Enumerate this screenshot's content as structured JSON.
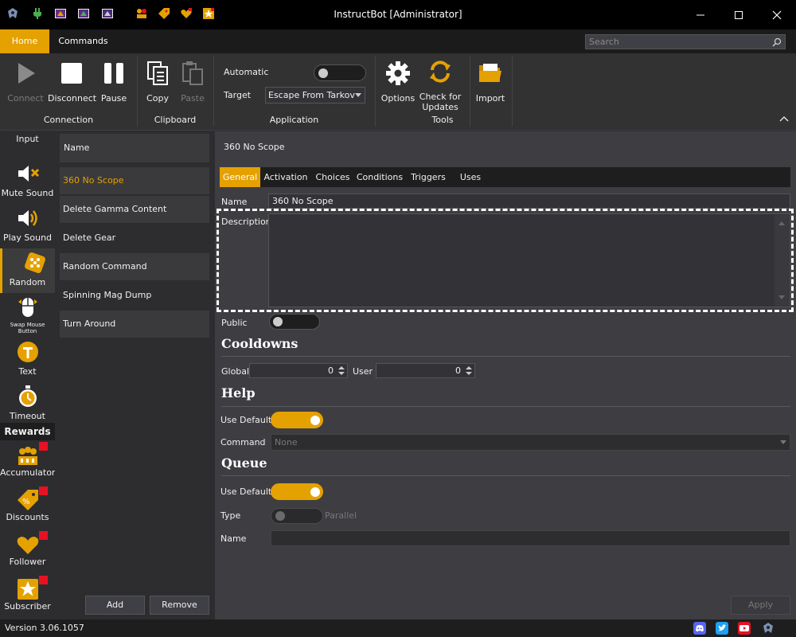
{
  "window": {
    "title": "InstructBot [Administrator]"
  },
  "titlebar_icons": [
    "app-logo-icon",
    "plug-icon",
    "scene-icon",
    "scene-icon-2",
    "scene-icon-3",
    "accumulator-icon",
    "discount-icon",
    "follower-heart-icon",
    "subscriber-star-icon"
  ],
  "tabs": [
    {
      "label": "Home"
    },
    {
      "label": "Commands"
    }
  ],
  "search": {
    "placeholder": "Search"
  },
  "ribbon": {
    "connection": {
      "label": "Connection",
      "connect": "Connect",
      "disconnect": "Disconnect",
      "pause": "Pause"
    },
    "clipboard": {
      "label": "Clipboard",
      "copy": "Copy",
      "paste": "Paste"
    },
    "application": {
      "label": "Application",
      "automatic": "Automatic",
      "target": "Target",
      "target_value": "Escape From Tarkov",
      "automatic_on": false
    },
    "tools": {
      "label": "Tools",
      "options": "Options",
      "check_updates_1": "Check for",
      "check_updates_2": "Updates"
    },
    "import": {
      "label": "Import"
    }
  },
  "nav": {
    "input": "Input",
    "mute_sound": "Mute Sound",
    "play_sound": "Play Sound",
    "random": "Random",
    "swap_mouse": "Swap Mouse Button",
    "text": "Text",
    "timeout": "Timeout",
    "rewards_header": "Rewards",
    "accumulator": "Accumulator",
    "discounts": "Discounts",
    "follower": "Follower",
    "subscriber": "Subscriber"
  },
  "list": {
    "header": "Name",
    "items": [
      "360 No Scope",
      "Delete Gamma Content",
      "Delete Gear",
      "Random Command",
      "Spinning Mag Dump",
      "Turn Around"
    ],
    "add": "Add",
    "remove": "Remove"
  },
  "detail": {
    "title": "360 No Scope",
    "tabs": [
      "General",
      "Activation",
      "Choices",
      "Conditions",
      "Triggers",
      "Uses"
    ],
    "name_label": "Name",
    "name_value": "360 No Scope",
    "description_label": "Description",
    "description_value": "",
    "public_label": "Public",
    "cooldowns_header": "Cooldowns",
    "global_label": "Global",
    "global_value": "0",
    "user_label": "User",
    "user_value": "0",
    "help_header": "Help",
    "help_use_default_label": "Use Default",
    "command_label": "Command",
    "command_value": "None",
    "queue_header": "Queue",
    "queue_use_default_label": "Use Default",
    "type_label": "Type",
    "type_value": "Parallel",
    "queue_name_label": "Name",
    "queue_name_value": "",
    "apply": "Apply"
  },
  "status": {
    "version": "Version 3.06.1057"
  },
  "colors": {
    "accent": "#e5a100",
    "background": "#2d2d30",
    "panel": "#3e3e42",
    "badge": "#e81123"
  }
}
